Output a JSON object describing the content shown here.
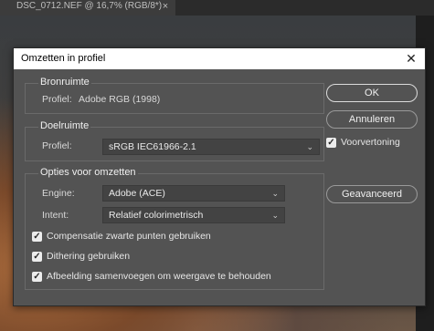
{
  "document": {
    "tab_title": "DSC_0712.NEF @ 16,7% (RGB/8*)",
    "tab_close": "×"
  },
  "dialog": {
    "title": "Omzetten in profiel",
    "close": "✕",
    "source": {
      "heading": "Bronruimte",
      "profile_label": "Profiel:",
      "profile_value": "Adobe RGB (1998)"
    },
    "destination": {
      "heading": "Doelruimte",
      "profile_label": "Profiel:",
      "profile_value": "sRGB IEC61966-2.1"
    },
    "options": {
      "heading": "Opties voor omzetten",
      "engine_label": "Engine:",
      "engine_value": "Adobe (ACE)",
      "intent_label": "Intent:",
      "intent_value": "Relatief colorimetrisch",
      "black_point": {
        "label": "Compensatie zwarte punten gebruiken",
        "checked": true
      },
      "dither": {
        "label": "Dithering gebruiken",
        "checked": true
      },
      "flatten": {
        "label": "Afbeelding samenvoegen om weergave te behouden",
        "checked": true
      }
    },
    "buttons": {
      "ok": "OK",
      "cancel": "Annuleren",
      "preview": {
        "label": "Voorvertoning",
        "checked": true
      },
      "advanced": "Geavanceerd"
    },
    "checkmark": "✓",
    "caret": "⌄"
  }
}
